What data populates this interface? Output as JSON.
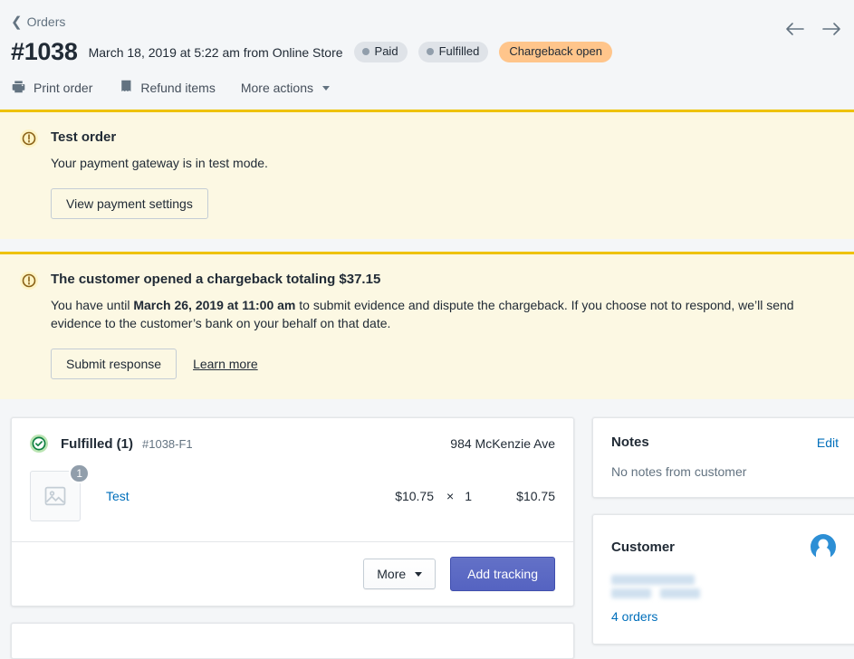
{
  "header": {
    "breadcrumb": "Orders",
    "order_number": "#1038",
    "order_meta": "March 18, 2019 at 5:22 am from Online Store",
    "badges": [
      {
        "label": "Paid",
        "type": "neutral"
      },
      {
        "label": "Fulfilled",
        "type": "neutral"
      },
      {
        "label": "Chargeback open",
        "type": "warning",
        "color": "#ffc58b"
      }
    ],
    "nav_prev_icon": "arrow-left-icon",
    "nav_next_icon": "arrow-right-icon"
  },
  "actions": {
    "print_order": "Print order",
    "refund_items": "Refund items",
    "more_actions": "More actions"
  },
  "banners": [
    {
      "icon": "warning-icon",
      "title": "Test order",
      "text": "Your payment gateway is in test mode.",
      "button": "View payment settings",
      "accent": "#eec200",
      "background": "#fcf8e3"
    },
    {
      "icon": "warning-icon",
      "title": "The customer opened a chargeback totaling $37.15",
      "text_prefix": "You have until ",
      "text_bold": "March 26, 2019 at 11:00 am",
      "text_suffix": " to submit evidence and dispute the chargeback. If you choose not to respond, we’ll send evidence to the customer’s bank on your behalf on that date.",
      "button": "Submit response",
      "link": "Learn more",
      "accent": "#eec200",
      "background": "#fcf8e3"
    }
  ],
  "fulfillment": {
    "status_icon": "check-circle-icon",
    "title": "Fulfilled (1)",
    "reference": "#1038-F1",
    "address": "984 McKenzie Ave",
    "line_item": {
      "thumbnail_icon": "image-placeholder-icon",
      "quantity_badge": "1",
      "name": "Test",
      "unit_price": "$10.75",
      "multiply_symbol": "×",
      "quantity": "1",
      "total": "$10.75"
    },
    "more_button": "More",
    "add_tracking_button": "Add tracking",
    "primary_color": "#5c6ac4"
  },
  "notes": {
    "title": "Notes",
    "edit": "Edit",
    "body": "No notes from customer"
  },
  "customer": {
    "title": "Customer",
    "avatar_icon": "customer-avatar-icon",
    "name_redacted": true,
    "orders_link": "4 orders"
  }
}
